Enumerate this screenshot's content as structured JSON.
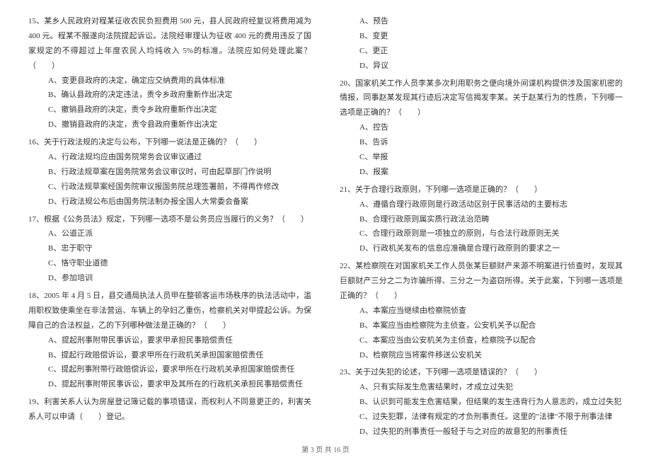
{
  "left": {
    "q15": {
      "text": "15、某乡人民政府对程某征收农民负担费用 500 元，县人民政府经复议将费用减为 400 元。程某不服遂向法院提起诉讼。法院经审理认为征收 400 元的费用违反了国家规定的不得超过上年度农民人均纯收入 5%的标准。法院应如何处理此案？（　　）",
      "a": "A、变更县政府的决定，确定应交纳费用的具体标准",
      "b": "B、确认县政府的决定违法，责令乡政府重新作出决定",
      "c": "C、撤销县政府的决定，责令乡政府重新作出决定",
      "d": "D、撤销县政府的决定，责令县政府重新作出决定"
    },
    "q16": {
      "text": "16、关于行政法规的决定与公布，下列哪一说法是正确的？（　　）",
      "a": "A、行政法规均应由国务院常务会议审议通过",
      "b": "B、行政法规草案在国务院常务会议审议时，可由起草部门作说明",
      "c": "C、行政法规草案经国务院审议报国务院总理签署前，不得再作修改",
      "d": "D、行政法规公布后由国务院法制办报全国人大常委会备案"
    },
    "q17": {
      "text": "17、根据《公务员法》规定，下列哪一选项不是公务员应当履行的义务？（　　）",
      "a": "A、公道正派",
      "b": "B、忠于职守",
      "c": "C、恪守职业道德",
      "d": "D、参加培训"
    },
    "q18": {
      "text": "18、2005 年 4 月 5 日，县交通局执法人员甲在整顿客运市场秩序的执法活动中，滥用职权致使乘坐在非法营运、车辆上的孕妇乙重伤，检察机关对甲提起公诉。为保障自己的合法权益，乙的下列哪种做法是正确的？（　　）",
      "a": "A、提起刑事附带民事诉讼，要求甲承担民事赔偿责任",
      "b": "B、提起行政赔偿诉讼，要求甲所在行政机关承担国家赔偿责任",
      "c": "C、提起刑事附带行政赔偿诉讼，要求甲所在行政机关承担国家赔偿责任",
      "d": "D、提起刑事附带民事诉讼，要求甲及其所在的行政机关承担民事赔偿责任"
    },
    "q19": {
      "text": "19、利害关系人认为房屋登记簿记载的事项错误，而权利人不同意更正的，利害关系人可以申请（　　）登记。"
    }
  },
  "right": {
    "q19opts": {
      "a": "A、预告",
      "b": "B、变更",
      "c": "C、更正",
      "d": "D、异议"
    },
    "q20": {
      "text": "20、国家机关工作人员李某多次利用职务之便向境外间谍机构提供涉及国家机密的情报，同事赵某发现其行迹后决定写信揭发李某。关于赵某行为的性质，下列哪一选项是正确的？（　　）",
      "a": "A、控告",
      "b": "B、告诉",
      "c": "C、举报",
      "d": "D、报案"
    },
    "q21": {
      "text": "21、关于合理行政原则，下列哪一选项是正确的？（　　）",
      "a": "A、遵循合理行政原则是行政活动区别于民事活动的主要标志",
      "b": "B、合理行政原则属实质行政法治范畴",
      "c": "C、合理行政原则是一项独立的原则，与合法行政原则无关",
      "d": "D、行政机关发布的信息应准确是合理行政原则的要求之一"
    },
    "q22": {
      "text": "22、某检察院在对国家机关工作人员张某巨额财产来源不明案进行侦查时，发现其巨额财产三分之二为诈骗所得、三分之一为盗窃所得。关于此案，下列哪一选项是正确的？（　　）",
      "a": "A、本案应当继续由检察院侦查",
      "b": "B、本案应当由检察院为主侦查，公安机关予以配合",
      "c": "C、本案应当由公安机关为主侦查，检察院予以配合",
      "d": "D、检察院应当将案件移送公安机关"
    },
    "q23": {
      "text": "23、关于过失犯的论述，下列哪一选项是错误的？（　　）",
      "a": "A、只有实际发生危害结果时，才成立过失犯",
      "b": "B、认识到可能发生危害结果，但结果的发生违背行为人意志的，成立过失犯",
      "c": "C、过失犯罪，法律有规定的才负刑事责任。这里的\"法律\"不限于刑事法律",
      "d": "D、过失犯的刑事责任一般轻于与之对应的故意犯的刑事责任"
    }
  },
  "footer": "第 3 页 共 16 页"
}
